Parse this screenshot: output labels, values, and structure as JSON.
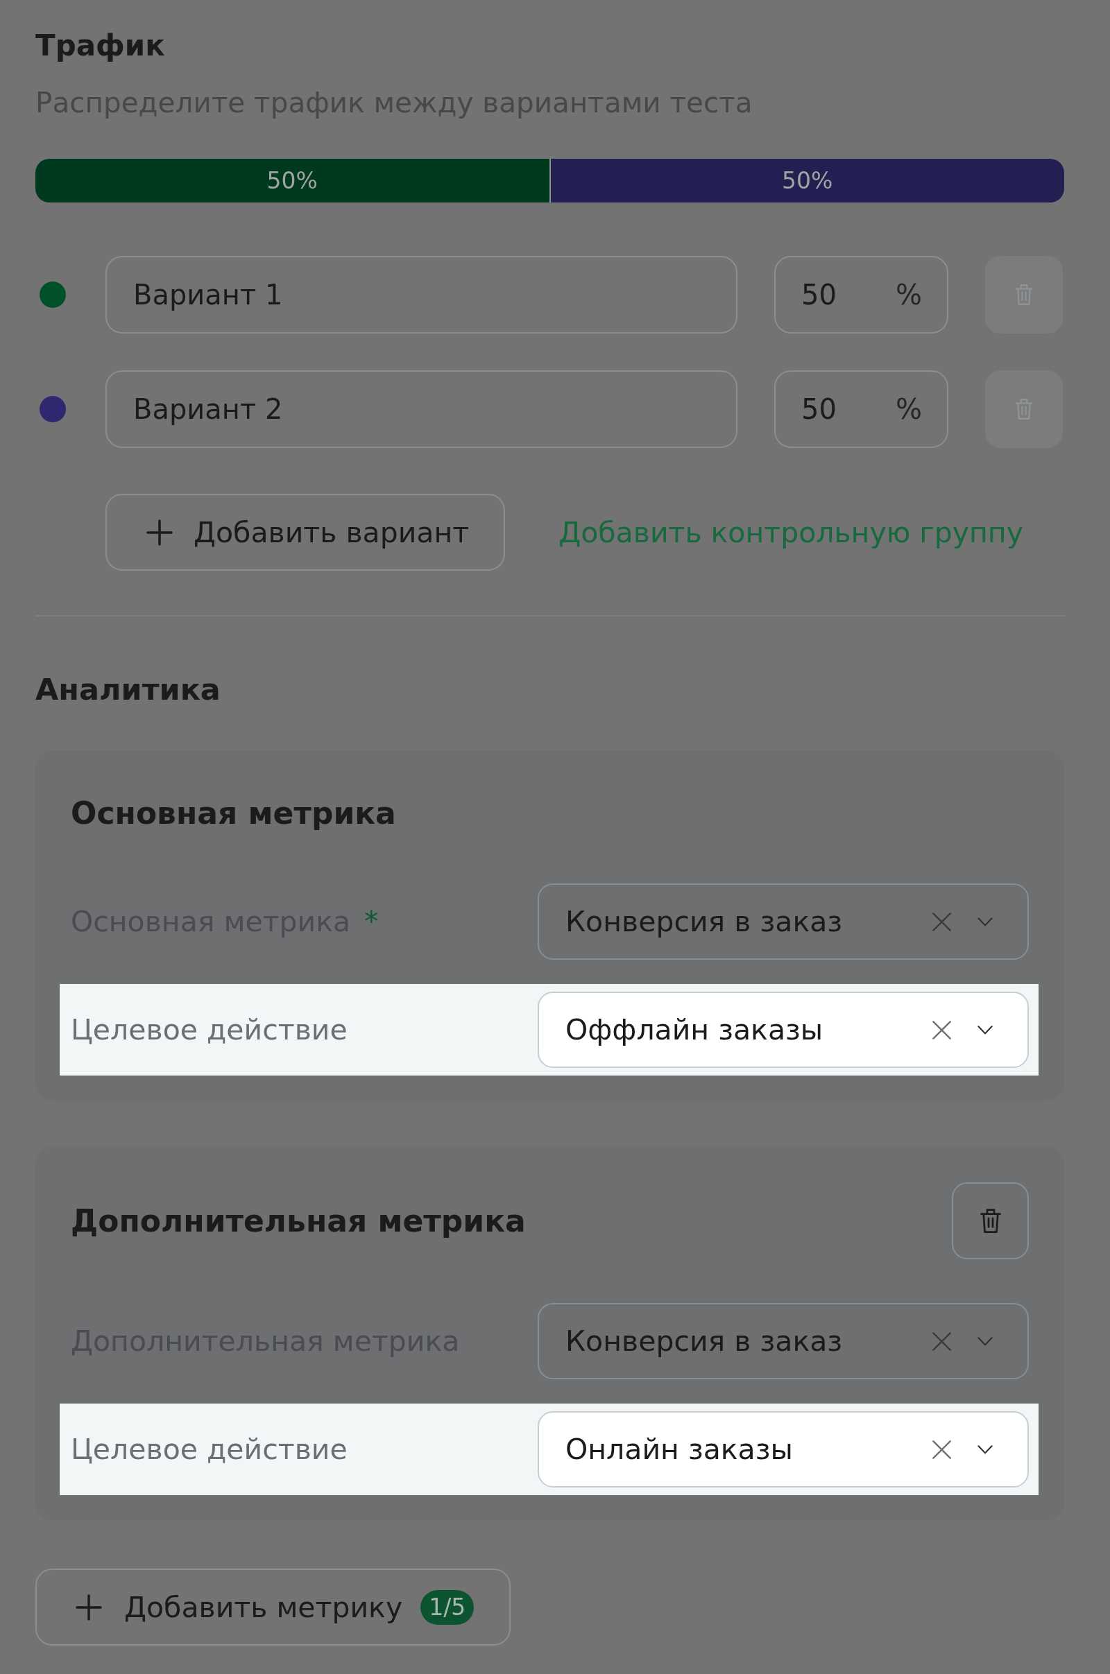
{
  "traffic": {
    "title": "Трафик",
    "subtitle": "Распределите трафик между вариантами теста",
    "distribution": [
      {
        "label": "50%",
        "level": 0.5,
        "color": "#003a1e"
      },
      {
        "label": "50%",
        "level": 0.5,
        "color": "#241f52"
      }
    ],
    "variants": [
      {
        "color": "#00512a",
        "name": "Вариант 1",
        "percent": "50",
        "unit": "%",
        "delete_button": {
          "disabled": true
        }
      },
      {
        "color": "#2e2870",
        "name": "Вариант 2",
        "percent": "50",
        "unit": "%",
        "delete_button": {
          "disabled": true
        }
      }
    ],
    "add_variant_button": "Добавить вариант",
    "add_control_group_link": "Добавить контрольную группу"
  },
  "analytics": {
    "title": "Аналитика",
    "metric_cards": [
      {
        "title": "Основная метрика",
        "deletable": false,
        "fields": [
          {
            "label": "Основная метрика",
            "required_mark": "*",
            "value": "Конверсия в заказ",
            "highlighted": false
          },
          {
            "label": "Целевое действие",
            "value": "Оффлайн заказы",
            "highlighted": true
          }
        ]
      },
      {
        "title": "Дополнительная метрика",
        "deletable": true,
        "fields": [
          {
            "label": "Дополнительная метрика",
            "value": "Конверсия в заказ",
            "highlighted": false
          },
          {
            "label": "Целевое действие",
            "value": "Онлайн заказы",
            "highlighted": true
          }
        ]
      }
    ],
    "add_metric_button": {
      "label": "Добавить метрику",
      "badge": "1/5"
    }
  }
}
